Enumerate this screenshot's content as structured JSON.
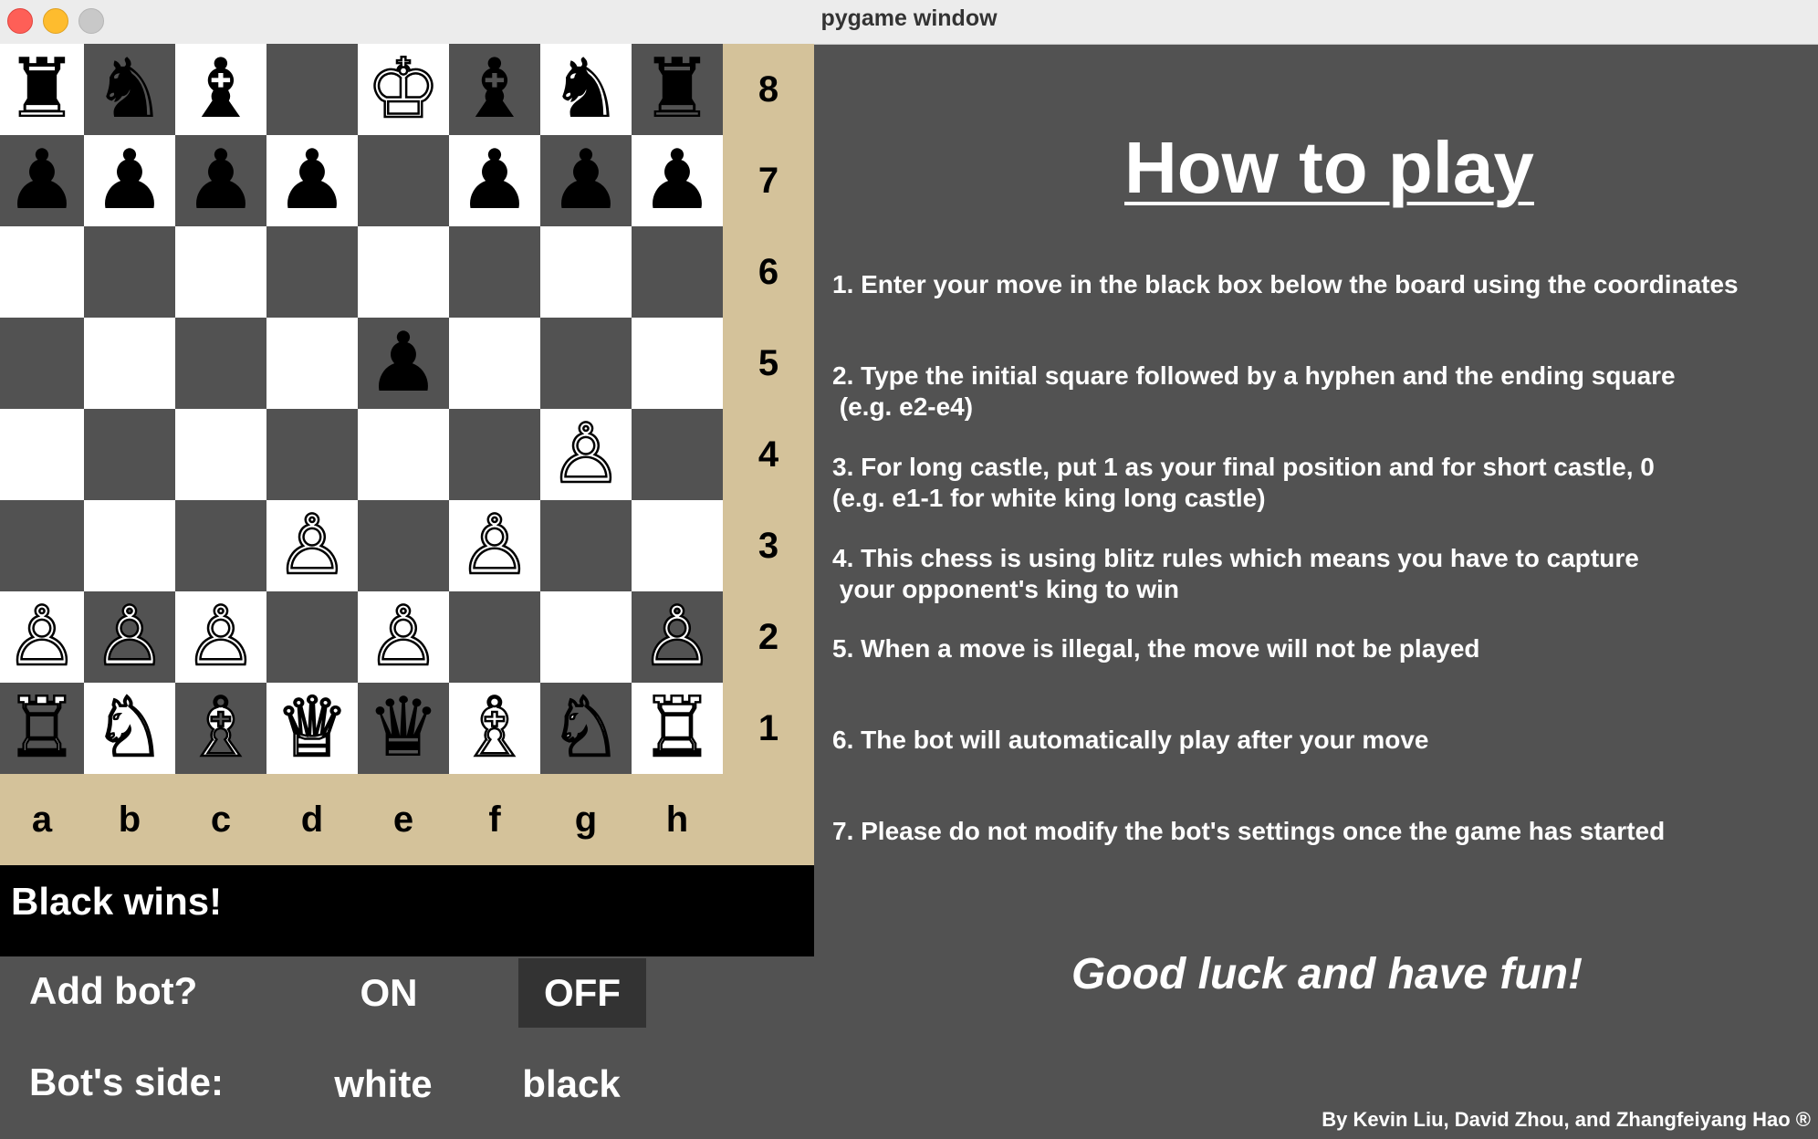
{
  "window": {
    "title": "pygame window"
  },
  "board": {
    "ranks": [
      "8",
      "7",
      "6",
      "5",
      "4",
      "3",
      "2",
      "1"
    ],
    "files": [
      "a",
      "b",
      "c",
      "d",
      "e",
      "f",
      "g",
      "h"
    ],
    "rows": [
      [
        {
          "g": "♜",
          "c": "black"
        },
        {
          "g": "♞",
          "c": "black"
        },
        {
          "g": "♝",
          "c": "black"
        },
        null,
        {
          "g": "♔",
          "c": "white"
        },
        {
          "g": "♝",
          "c": "black"
        },
        {
          "g": "♞",
          "c": "black"
        },
        {
          "g": "♜",
          "c": "black"
        }
      ],
      [
        {
          "g": "♟",
          "c": "black"
        },
        {
          "g": "♟",
          "c": "black"
        },
        {
          "g": "♟",
          "c": "black"
        },
        {
          "g": "♟",
          "c": "black"
        },
        null,
        {
          "g": "♟",
          "c": "black"
        },
        {
          "g": "♟",
          "c": "black"
        },
        {
          "g": "♟",
          "c": "black"
        }
      ],
      [
        null,
        null,
        null,
        null,
        null,
        null,
        null,
        null
      ],
      [
        null,
        null,
        null,
        null,
        {
          "g": "♟",
          "c": "black"
        },
        null,
        null,
        null
      ],
      [
        null,
        null,
        null,
        null,
        null,
        null,
        {
          "g": "♙",
          "c": "white"
        },
        null
      ],
      [
        null,
        null,
        null,
        {
          "g": "♙",
          "c": "white"
        },
        null,
        {
          "g": "♙",
          "c": "white"
        },
        null,
        null
      ],
      [
        {
          "g": "♙",
          "c": "white"
        },
        {
          "g": "♙",
          "c": "white"
        },
        {
          "g": "♙",
          "c": "white"
        },
        null,
        {
          "g": "♙",
          "c": "white"
        },
        null,
        null,
        {
          "g": "♙",
          "c": "white"
        }
      ],
      [
        {
          "g": "♖",
          "c": "white"
        },
        {
          "g": "♘",
          "c": "white"
        },
        {
          "g": "♗",
          "c": "white"
        },
        {
          "g": "♕",
          "c": "white"
        },
        {
          "g": "♛",
          "c": "black"
        },
        {
          "g": "♗",
          "c": "white"
        },
        {
          "g": "♘",
          "c": "white"
        },
        {
          "g": "♖",
          "c": "white"
        }
      ]
    ]
  },
  "status": {
    "text": "Black wins!"
  },
  "controls": {
    "add_bot_label": "Add bot?",
    "on_label": "ON",
    "off_label": "OFF",
    "selected": "OFF",
    "bot_side_label": "Bot's side:",
    "white_label": "white",
    "black_label": "black"
  },
  "panel": {
    "title": "How to play",
    "rules": [
      "1. Enter your move in the black box below the board using the coordinates",
      "2. Type the initial square followed by a hyphen and the ending square\n (e.g. e2-e4)",
      "3. For long castle, put 1 as your final position and for short castle, 0\n(e.g. e1-1 for white king long castle)",
      "4. This chess is using blitz rules which means you have to capture\n your opponent's king to win",
      "5. When a move is illegal, the move will not be played",
      "6. The bot will automatically play after your move",
      "7. Please do not modify the bot's settings once the game has started"
    ],
    "good_luck": "Good luck and have fun!",
    "credits": "By Kevin Liu, David Zhou, and Zhangfeiyang Hao ®"
  },
  "colors": {
    "light_square": "#ffffff",
    "dark_square": "#525252",
    "label_strip": "#d4c29a",
    "background": "#525252"
  }
}
